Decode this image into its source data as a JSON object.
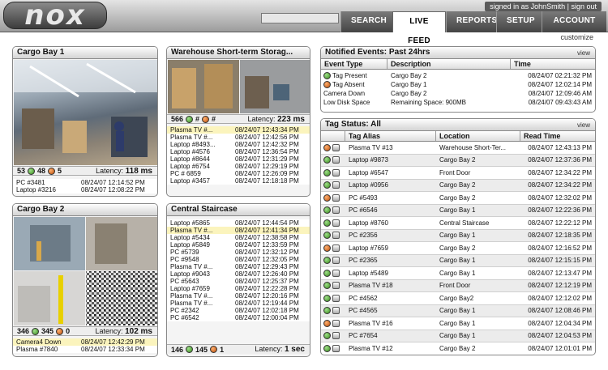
{
  "header": {
    "logo": "nox",
    "signin": "signed in as JohnSmith | sign out",
    "nav": [
      {
        "label": "SEARCH",
        "active": false
      },
      {
        "label": "LIVE FEED",
        "active": true
      },
      {
        "label": "REPORTS",
        "active": false
      },
      {
        "label": "SETUP",
        "active": false
      },
      {
        "label": "ACCOUNT",
        "active": false
      }
    ],
    "customize": "customize"
  },
  "cargo1": {
    "title": "Cargo Bay 1",
    "green": "48",
    "orange": "5",
    "total": "53",
    "latency_label": "Latency:",
    "latency": "118 ms",
    "rows": [
      [
        "PC #3481",
        "08/24/07 12:14:52 PM"
      ],
      [
        "Laptop #3216",
        "08/24/07 12:08:22 PM"
      ]
    ]
  },
  "cargo2": {
    "title": "Cargo Bay 2",
    "green": "345",
    "orange": "0",
    "total": "346",
    "latency_label": "Latency:",
    "latency": "102 ms",
    "rows": [
      [
        "Camera4 Down",
        "08/24/07 12:42:29 PM"
      ],
      [
        "Plasma #7840",
        "08/24/07 12:33:34 PM"
      ]
    ]
  },
  "warehouse": {
    "title": "Warehouse Short-term Storag...",
    "green": "#",
    "orange": "#",
    "total": "566",
    "latency_label": "Latency:",
    "latency": "223 ms",
    "rows": [
      [
        "Plasma TV #...",
        "08/24/07 12:43:34 PM"
      ],
      [
        "Plasma TV #...",
        "08/24/07 12:42:56 PM"
      ],
      [
        "Laptop #8493...",
        "08/24/07 12:42:32 PM"
      ],
      [
        "Laptop #4576",
        "08/24/07 12:36:54 PM"
      ],
      [
        "Laptop #8644",
        "08/24/07 12:31:29 PM"
      ],
      [
        "Laptop #6754",
        "08/24/07 12:29:19 PM"
      ],
      [
        "PC # 6859",
        "08/24/07 12:26:09 PM"
      ],
      [
        "Laptop #3457",
        "08/24/07 12:18:18 PM"
      ]
    ]
  },
  "staircase": {
    "title": "Central Staircase",
    "green": "145",
    "orange": "1",
    "total": "146",
    "latency_label": "Latency:",
    "latency": "1 sec",
    "rows": [
      [
        "Laptop #5865",
        "08/24/07 12:44:54 PM"
      ],
      [
        "Plasma TV #...",
        "08/24/07 12:41:34 PM"
      ],
      [
        "Laptop #5434",
        "08/24/07 12:38:58 PM"
      ],
      [
        "Laptop #5849",
        "08/24/07 12:33:59 PM"
      ],
      [
        "PC #5739",
        "08/24/07 12:32:12 PM"
      ],
      [
        "PC #9548",
        "08/24/07 12:32:05 PM"
      ],
      [
        "Plasma TV #...",
        "08/24/07 12:29:43 PM"
      ],
      [
        "Laptop #9043",
        "08/24/07 12:26:40 PM"
      ],
      [
        "PC #5643",
        "08/24/07 12:25:37 PM"
      ],
      [
        "Laptop #7659",
        "08/24/07 12:22:28 PM"
      ],
      [
        "Plasma TV #...",
        "08/24/07 12:20:16 PM"
      ],
      [
        "Plasma TV #...",
        "08/24/07 12:19:44 PM"
      ],
      [
        "PC #2342",
        "08/24/07 12:02:18 PM"
      ],
      [
        "PC #6542",
        "08/24/07 12:00:04 PM"
      ]
    ]
  },
  "events": {
    "title": "Notified Events:  Past 24hrs",
    "view": "view",
    "headers": [
      "Event Type",
      "Description",
      "Time"
    ],
    "rows": [
      {
        "icon": "green",
        "type": "Tag Present",
        "desc": "Cargo Bay 2",
        "time": "08/24/07 02:21:32 PM"
      },
      {
        "icon": "orange",
        "type": "Tag Absent",
        "desc": "Cargo Bay 1",
        "time": "08/24/07 12:02:14 PM"
      },
      {
        "icon": "",
        "type": "Camera Down",
        "desc": "Cargo Bay 2",
        "time": "08/24/07 12:09:46 AM"
      },
      {
        "icon": "",
        "type": "Low Disk Space",
        "desc": "Remaining Space: 900MB",
        "time": "08/24/07 09:43:43 AM"
      }
    ]
  },
  "tagstatus": {
    "title": "Tag Status:  All",
    "view": "view",
    "headers": [
      "Tag Alias",
      "Location",
      "Read Time"
    ],
    "rows": [
      {
        "s": "orange",
        "alias": "Plasma TV #13",
        "loc": "Warehouse Short-Ter...",
        "time": "08/24/07 12:43:13 PM"
      },
      {
        "s": "green",
        "alias": "Laptop #9873",
        "loc": "Cargo Bay 2",
        "time": "08/24/07 12:37:36 PM"
      },
      {
        "s": "green",
        "alias": "Laptop #6547",
        "loc": "Front Door",
        "time": "08/24/07 12:34:22 PM"
      },
      {
        "s": "green",
        "alias": "Laptop #0956",
        "loc": "Cargo Bay 2",
        "time": "08/24/07 12:34:22 PM"
      },
      {
        "s": "orange",
        "alias": "PC #5493",
        "loc": "Cargo Bay 2",
        "time": "08/24/07 12:32:02 PM"
      },
      {
        "s": "green",
        "alias": "PC #6546",
        "loc": "Cargo Bay 1",
        "time": "08/24/07 12:22:36 PM"
      },
      {
        "s": "green",
        "alias": "Laptop #8760",
        "loc": "Central Staircase",
        "time": "08/24/07 12:22:12 PM"
      },
      {
        "s": "green",
        "alias": "PC #2356",
        "loc": "Cargo Bay 1",
        "time": "08/24/07 12:18:35 PM"
      },
      {
        "s": "orange",
        "alias": "Laptop #7659",
        "loc": "Cargo Bay 2",
        "time": "08/24/07 12:16:52 PM"
      },
      {
        "s": "green",
        "alias": "PC #2365",
        "loc": "Cargo Bay 1",
        "time": "08/24/07 12:15:15 PM"
      },
      {
        "s": "green",
        "alias": "Laptop #5489",
        "loc": "Cargo Bay 1",
        "time": "08/24/07 12:13:47 PM"
      },
      {
        "s": "green",
        "alias": "Plasma TV #18",
        "loc": "Front Door",
        "time": "08/24/07 12:12:19 PM"
      },
      {
        "s": "green",
        "alias": "PC #4562",
        "loc": "Cargo Bay2",
        "time": "08/24/07 12:12:02 PM"
      },
      {
        "s": "green",
        "alias": "PC #4565",
        "loc": "Cargo Bay 1",
        "time": "08/24/07 12:08:46 PM"
      },
      {
        "s": "orange",
        "alias": "Plasma TV #16",
        "loc": "Cargo Bay 1",
        "time": "08/24/07 12:04:34 PM"
      },
      {
        "s": "green",
        "alias": "PC #7654",
        "loc": "Cargo Bay 1",
        "time": "08/24/07 12:04:53 PM"
      },
      {
        "s": "green",
        "alias": "Plasma TV #12",
        "loc": "Cargo Bay 2",
        "time": "08/24/07 12:01:01 PM"
      }
    ]
  }
}
